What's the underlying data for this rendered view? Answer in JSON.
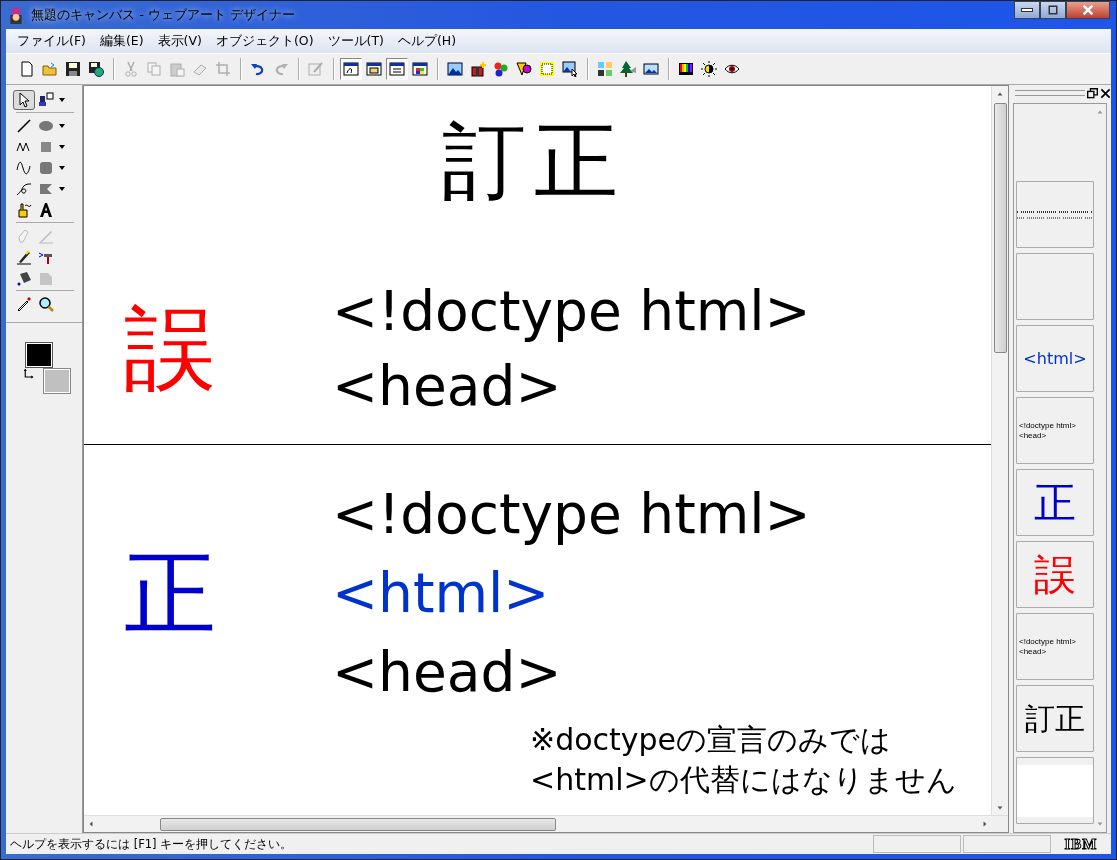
{
  "window": {
    "title": "無題のキャンバス - ウェブアート デザイナー"
  },
  "menu": [
    {
      "label": "ファイル(F)"
    },
    {
      "label": "編集(E)"
    },
    {
      "label": "表示(V)"
    },
    {
      "label": "オブジェクト(O)"
    },
    {
      "label": "ツール(T)"
    },
    {
      "label": "ヘルプ(H)"
    }
  ],
  "toolbar": [
    {
      "disabled": false,
      "pressed": false
    },
    {
      "disabled": false,
      "pressed": false
    },
    {
      "disabled": false,
      "pressed": false
    },
    {
      "disabled": false,
      "pressed": false
    },
    {
      "disabled": true,
      "pressed": false
    },
    {
      "disabled": true,
      "pressed": false
    },
    {
      "disabled": true,
      "pressed": false
    },
    {
      "disabled": true,
      "pressed": false
    },
    {
      "disabled": true,
      "pressed": false
    },
    {
      "disabled": false,
      "pressed": false
    },
    {
      "disabled": true,
      "pressed": false
    },
    {
      "disabled": true,
      "pressed": false
    },
    {
      "disabled": false,
      "pressed": true
    },
    {
      "disabled": false,
      "pressed": false
    },
    {
      "disabled": false,
      "pressed": true
    },
    {
      "disabled": false,
      "pressed": false
    },
    {
      "disabled": false,
      "pressed": false
    },
    {
      "disabled": false,
      "pressed": false
    },
    {
      "disabled": false,
      "pressed": false
    },
    {
      "disabled": false,
      "pressed": false
    },
    {
      "disabled": false,
      "pressed": false
    },
    {
      "disabled": false,
      "pressed": false
    },
    {
      "disabled": false,
      "pressed": false
    },
    {
      "disabled": false,
      "pressed": false
    },
    {
      "disabled": false,
      "pressed": false
    },
    {
      "disabled": false,
      "pressed": false
    },
    {
      "disabled": false,
      "pressed": false
    },
    {
      "disabled": false,
      "pressed": false
    }
  ],
  "tools": [
    {
      "selected": true,
      "disabled": false
    },
    {
      "selected": false,
      "disabled": false
    },
    {
      "selected": false,
      "disabled": false
    },
    {
      "selected": false,
      "disabled": false
    },
    {
      "selected": false,
      "disabled": false
    },
    {
      "selected": false,
      "disabled": false
    },
    {
      "selected": false,
      "disabled": false
    },
    {
      "selected": false,
      "disabled": false
    },
    {
      "selected": false,
      "disabled": false
    },
    {
      "selected": false,
      "disabled": false
    },
    {
      "selected": false,
      "disabled": false
    },
    {
      "selected": false,
      "disabled": false
    },
    {
      "selected": false,
      "disabled": true
    },
    {
      "selected": false,
      "disabled": true
    },
    {
      "selected": false,
      "disabled": false
    },
    {
      "selected": false,
      "disabled": false
    },
    {
      "selected": false,
      "disabled": false
    },
    {
      "selected": false,
      "disabled": true
    },
    {
      "selected": false,
      "disabled": false
    },
    {
      "selected": false,
      "disabled": false
    }
  ],
  "colors": {
    "foreground": {
      "color": "#000000"
    },
    "background": {
      "color": "#c0c0c0"
    }
  },
  "canvas": {
    "title": "訂正",
    "sections": [
      {
        "mark": "誤",
        "color": "#ff0000",
        "lines": [
          {
            "text": "<!doctype html>",
            "color": "#000000"
          },
          {
            "text": "<head>",
            "color": "#000000"
          }
        ]
      },
      {
        "mark": "正",
        "color": "#0000cc",
        "lines": [
          {
            "text": "<!doctype html>",
            "color": "#000000"
          },
          {
            "text": "<html>",
            "color": "#0033cc"
          },
          {
            "text": "<head>",
            "color": "#000000"
          }
        ]
      }
    ],
    "note": [
      "※doctypeの宣言のみでは",
      "<html>の代替にはなりません"
    ]
  },
  "thumbnails": [
    {
      "kind": "note"
    },
    {
      "kind": "blank"
    },
    {
      "kind": "medium",
      "text": "<html>",
      "color": "#0033cc"
    },
    {
      "kind": "tiny",
      "lines": [
        "<!doctype html>",
        "<head>"
      ]
    },
    {
      "kind": "large",
      "text": "正",
      "color": "#0000cc"
    },
    {
      "kind": "large",
      "text": "誤",
      "color": "#ff0000"
    },
    {
      "kind": "tiny",
      "lines": [
        "<!doctype html>",
        "<head>"
      ]
    },
    {
      "kind": "large",
      "text": "訂正",
      "color": "#000000"
    },
    {
      "kind": "white"
    }
  ],
  "status_bar": {
    "text": "ヘルプを表示するには [F1] キーを押してください。",
    "logo": "IBM"
  }
}
